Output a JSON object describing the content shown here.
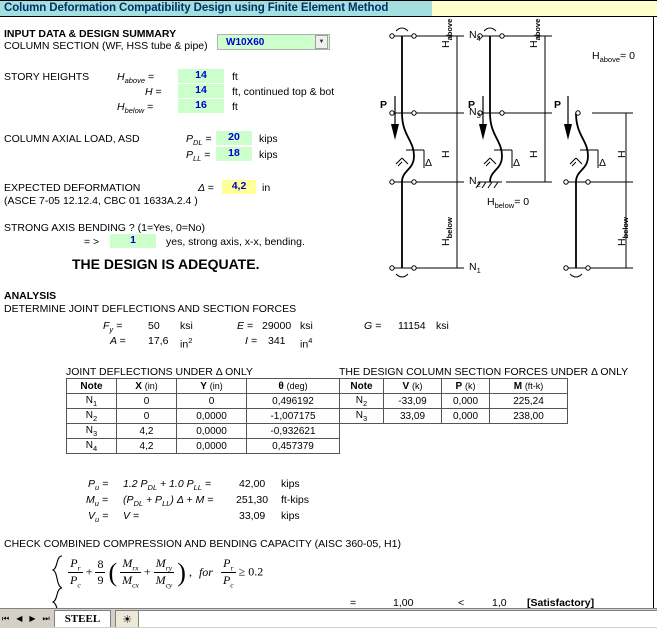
{
  "title": "Column Deformation Compatibility Design using Finite Element Method",
  "input_section": {
    "heading": "INPUT DATA & DESIGN SUMMARY",
    "section_label": "COLUMN SECTION (WF, HSS tube & pipe)",
    "section_value": "W10X60",
    "story_heights_label": "STORY HEIGHTS",
    "h_above_label": "H",
    "h_above_sub": "above",
    "h_above_eq": "=",
    "h_above_value": "14",
    "h_above_unit": "ft",
    "h_label": "H",
    "h_eq": "=",
    "h_value": "14",
    "h_unit": "ft, continued top & bot",
    "h_below_label": "H",
    "h_below_sub": "below",
    "h_below_eq": "=",
    "h_below_value": "16",
    "h_below_unit": "ft",
    "axial_label": "COLUMN AXIAL LOAD, ASD",
    "pdl_label": "P",
    "pdl_sub": "DL",
    "pdl_value": "20",
    "pdl_unit": "kips",
    "pll_label": "P",
    "pll_sub": "LL",
    "pll_value": "18",
    "pll_unit": "kips",
    "deform_label": "EXPECTED DEFORMATION",
    "deform_ref": "(ASCE 7-05 12.12.4, CBC 01 1633A.2.4 )",
    "delta_label": "Δ",
    "delta_value": "4,2",
    "delta_unit": "in",
    "strong_axis_label": "STRONG AXIS BENDING ? (1=Yes, 0=No)",
    "strong_axis_arrow": "= >",
    "strong_axis_value": "1",
    "strong_axis_note": "yes, strong axis, x-x, bending.",
    "verdict": "THE DESIGN IS ADEQUATE."
  },
  "analysis": {
    "heading": "ANALYSIS",
    "subheading": "DETERMINE JOINT DEFLECTIONS AND SECTION FORCES",
    "fy_label": "F",
    "fy_sub": "y",
    "fy_value": "50",
    "fy_unit": "ksi",
    "a_label": "A",
    "a_value": "17,6",
    "a_unit": "in",
    "a_unit_sup": "2",
    "e_label": "E",
    "e_value": "29000",
    "e_unit": "ksi",
    "i_label": "I",
    "i_value": "341",
    "i_unit": "in",
    "i_unit_sup": "4",
    "g_label": "G",
    "g_value": "11154",
    "g_unit": "ksi"
  },
  "deflection_table": {
    "caption": "JOINT DEFLECTIONS UNDER Δ ONLY",
    "headers": [
      "Note",
      "X (in)",
      "Y (in)",
      "θ (deg)"
    ],
    "rows": [
      {
        "note": "N",
        "sub": "1",
        "x": "0",
        "y": "0",
        "theta": "0,496192"
      },
      {
        "note": "N",
        "sub": "2",
        "x": "0",
        "y": "0,0000",
        "theta": "-1,007175"
      },
      {
        "note": "N",
        "sub": "3",
        "x": "4,2",
        "y": "0,0000",
        "theta": "-0,932621"
      },
      {
        "note": "N",
        "sub": "4",
        "x": "4,2",
        "y": "0,0000",
        "theta": "0,457379"
      }
    ]
  },
  "forces_table": {
    "caption": "THE DESIGN COLUMN SECTION FORCES UNDER Δ ONLY",
    "headers": [
      "Note",
      "V (k)",
      "P (k)",
      "M (ft-k)"
    ],
    "rows": [
      {
        "note": "N",
        "sub": "2",
        "v": "-33,09",
        "p": "0,000",
        "m": "225,24"
      },
      {
        "note": "N",
        "sub": "3",
        "v": "33,09",
        "p": "0,000",
        "m": "238,00"
      }
    ]
  },
  "design_forces": {
    "pu_label": "P",
    "pu_sub": "u",
    "pu_formula": "1.2 P",
    "pu_formula_sub1": "DL",
    "pu_formula_mid": " + 1.0 P",
    "pu_formula_sub2": "LL",
    "pu_value": "42,00",
    "pu_unit": "kips",
    "mu_label": "M",
    "mu_sub": "u",
    "mu_formula_a": "(P",
    "mu_formula_sub1": "DL",
    "mu_formula_b": " + P",
    "mu_formula_sub2": "LL",
    "mu_formula_c": ") Δ + M =",
    "mu_value": "251,30",
    "mu_unit": "ft-kips",
    "vu_label": "V",
    "vu_sub": "u",
    "vu_formula": "V =",
    "vu_value": "33,09",
    "vu_unit": "kips"
  },
  "check": {
    "heading": "CHECK COMBINED COMPRESSION AND BENDING CAPACITY (AISC 360-05, H1)",
    "eq_pr": "P",
    "eq_pr_sub": "r",
    "eq_pc": "P",
    "eq_pc_sub": "c",
    "eq_coef_num": "8",
    "eq_coef_den": "9",
    "eq_mrx": "M",
    "eq_mrx_sub": "rx",
    "eq_mcx": "M",
    "eq_mcx_sub": "cx",
    "eq_mry": "M",
    "eq_mry_sub": "ry",
    "eq_mcy": "M",
    "eq_mcy_sub": "cy",
    "eq_for": "for",
    "eq_cond": "≥ 0.2",
    "result_eq": "=",
    "result_value": "1,00",
    "comparator": "<",
    "limit_value": "1,0",
    "status": "[Satisfactory]"
  },
  "diagram": {
    "labels": {
      "n1": "N",
      "n1_sub": "1",
      "n2": "N",
      "n2_sub": "2",
      "n3": "N",
      "n3_sub": "3",
      "n4": "N",
      "n4_sub": "4",
      "h_above": "H",
      "h_above_sub": "above",
      "h": "H",
      "h_below": "H",
      "h_below_sub": "below",
      "p": "P",
      "delta": "Δ",
      "h_below_zero": "H",
      "h_below_zero_sub": "below",
      "h_below_zero_eq": "= 0",
      "h_above_zero": "H",
      "h_above_zero_sub": "above",
      "h_above_zero_eq": "= 0"
    }
  },
  "sheet_bar": {
    "first": "⏮",
    "prev": "◀",
    "next": "▶",
    "last": "⏭",
    "tab_active": "STEEL",
    "tab_add": "☀"
  },
  "colors": {
    "title_bg": "#a5dee0",
    "title_bg_right": "#ffffcc",
    "input_bg": "#ccffcc",
    "highlight_bg": "#ffff99",
    "value_text": "#0000cc"
  }
}
